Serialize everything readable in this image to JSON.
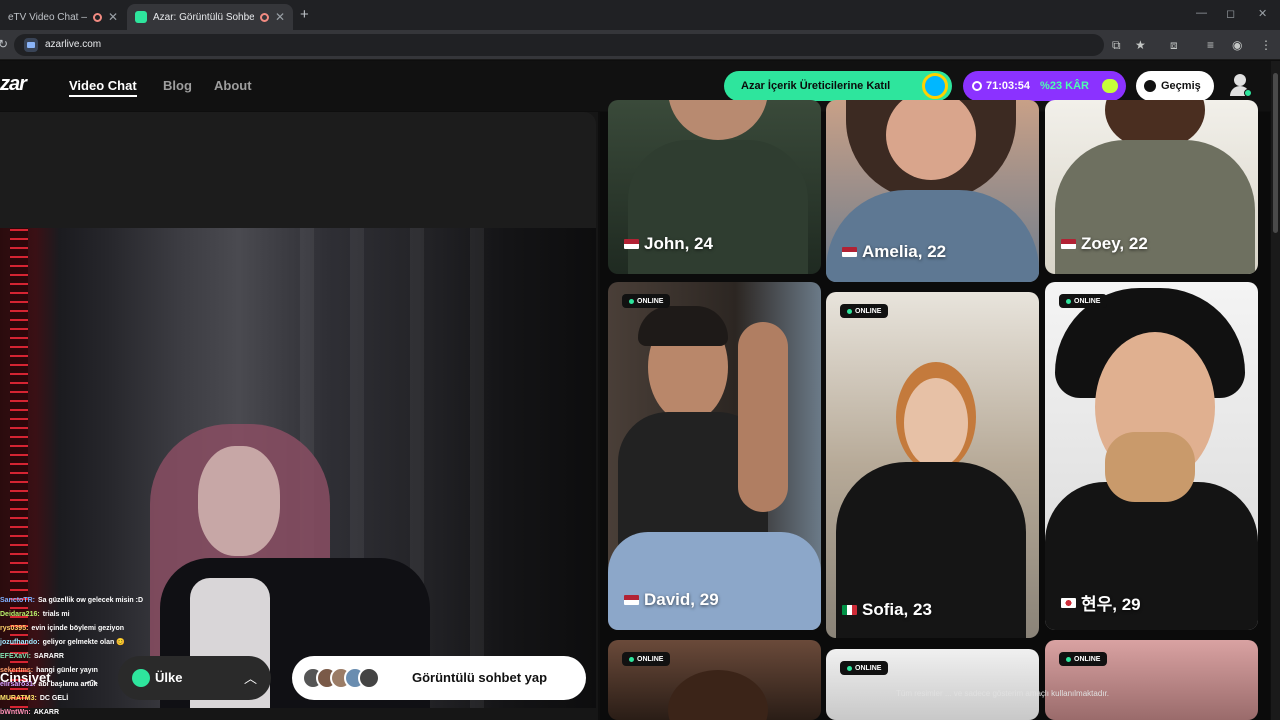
{
  "browser": {
    "tabs": [
      {
        "title": "eTV Video Chat — Ome",
        "close": "✕"
      },
      {
        "title": "Azar: Görüntülü Sohbet & V",
        "close": "✕"
      }
    ],
    "new_tab": "+",
    "url": "azarlive.com",
    "window_controls": {
      "minimize": "—",
      "maximize": "◻",
      "close": "✕"
    },
    "address_icons": {
      "install": "⧉",
      "bookmark": "★",
      "extensions": "⧈",
      "media": "≡",
      "profile": "◉",
      "menu": "⋮"
    }
  },
  "site": {
    "logo": "zar",
    "nav": {
      "video_chat": "Video Chat",
      "blog": "Blog",
      "about": "About"
    },
    "creators_button": "Azar İçerik Üreticilerine Katıl",
    "promo": {
      "timer": "71:03:54",
      "discount": "%23 KÂR"
    },
    "history_button": "Geçmiş"
  },
  "chat": [
    {
      "user": "SanctoTR:",
      "text": "Sa güzellik ow gelecek misin :D",
      "color": "#7fb0ff"
    },
    {
      "user": "Deidara216:",
      "text": "trials mi",
      "color": "#b7f06b"
    },
    {
      "user": "rys0395:",
      "text": "evin içinde böylemi geziyon",
      "color": "#ffd36b"
    },
    {
      "user": "jozufhando:",
      "text": "geliyor gelmekte olan 😊",
      "color": "#9fe8ff"
    },
    {
      "user": "EFEXaVi:",
      "text": "SARARR",
      "color": "#7fe0b0"
    },
    {
      "user": "sekertms:",
      "text": "hangi günler yayın",
      "color": "#ff9f6b"
    },
    {
      "user": "elirsaro31:",
      "text": "abi başlama artuk",
      "color": "#d29fff"
    },
    {
      "user": "MURATM3:",
      "text": "DC GELİ",
      "color": "#ffe56b"
    },
    {
      "user": "bWntWn:",
      "text": "AKARR",
      "color": "#ff8fb5"
    }
  ],
  "controls": {
    "gender_label": "Cinsiyet",
    "country_label": "Ülke",
    "start_button": "Görüntülü sohbet yap"
  },
  "profiles": [
    {
      "name": "John, 24",
      "flag": "us",
      "online": false
    },
    {
      "name": "Amelia, 22",
      "flag": "us",
      "online": false
    },
    {
      "name": "Zoey, 22",
      "flag": "us",
      "online": false
    },
    {
      "name": "David, 29",
      "flag": "us",
      "online": true
    },
    {
      "name": "Sofia, 23",
      "flag": "it",
      "online": true
    },
    {
      "name": "현우, 29",
      "flag": "kr",
      "online": true
    },
    {
      "name": "",
      "flag": "",
      "online": true
    },
    {
      "name": "",
      "flag": "",
      "online": true
    },
    {
      "name": "",
      "flag": "",
      "online": true
    }
  ],
  "online_badge": "ONLINE",
  "footer_note": "Tüm resimler ... ve sadece gösterim amaçlı kullanılmaktadır.",
  "colors": {
    "brand_green": "#2ee59d",
    "promo_purple": "#8b32ff",
    "background": "#0e0e0e"
  }
}
